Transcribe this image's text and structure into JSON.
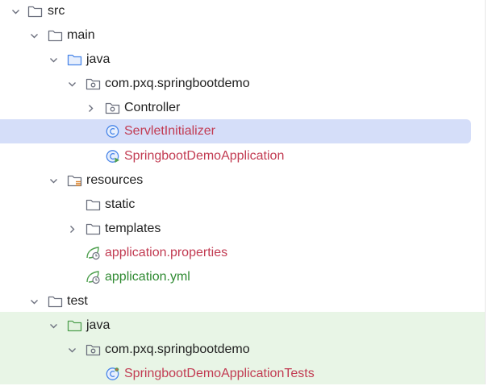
{
  "tree": {
    "src": "src",
    "main": "main",
    "main_java": "java",
    "main_pkg": "com.pxq.springbootdemo",
    "controller": "Controller",
    "servlet_initializer": "ServletInitializer",
    "app_class": "SpringbootDemoApplication",
    "resources": "resources",
    "static": "static",
    "templates": "templates",
    "app_properties": "application.properties",
    "app_yml": "application.yml",
    "test": "test",
    "test_java": "java",
    "test_pkg": "com.pxq.springbootdemo",
    "test_class": "SpringbootDemoApplicationTests"
  },
  "colors": {
    "selection": "#d5def9",
    "test_background": "#e8f5e6",
    "modified_file": "#c23b52",
    "new_file": "#2f8a32",
    "source_folder": "#4a86e8",
    "test_folder": "#4fa04f"
  },
  "icons": {
    "folder": "folder-icon",
    "source_folder": "source-folder-icon",
    "package": "package-icon",
    "resources_folder": "resources-folder-icon",
    "test_folder": "test-folder-icon",
    "class": "class-icon",
    "spring_boot_app": "spring-boot-application-icon",
    "spring_config": "spring-config-icon",
    "test_class": "test-class-icon",
    "expand": "chevron-down-icon",
    "collapse": "chevron-right-icon"
  }
}
